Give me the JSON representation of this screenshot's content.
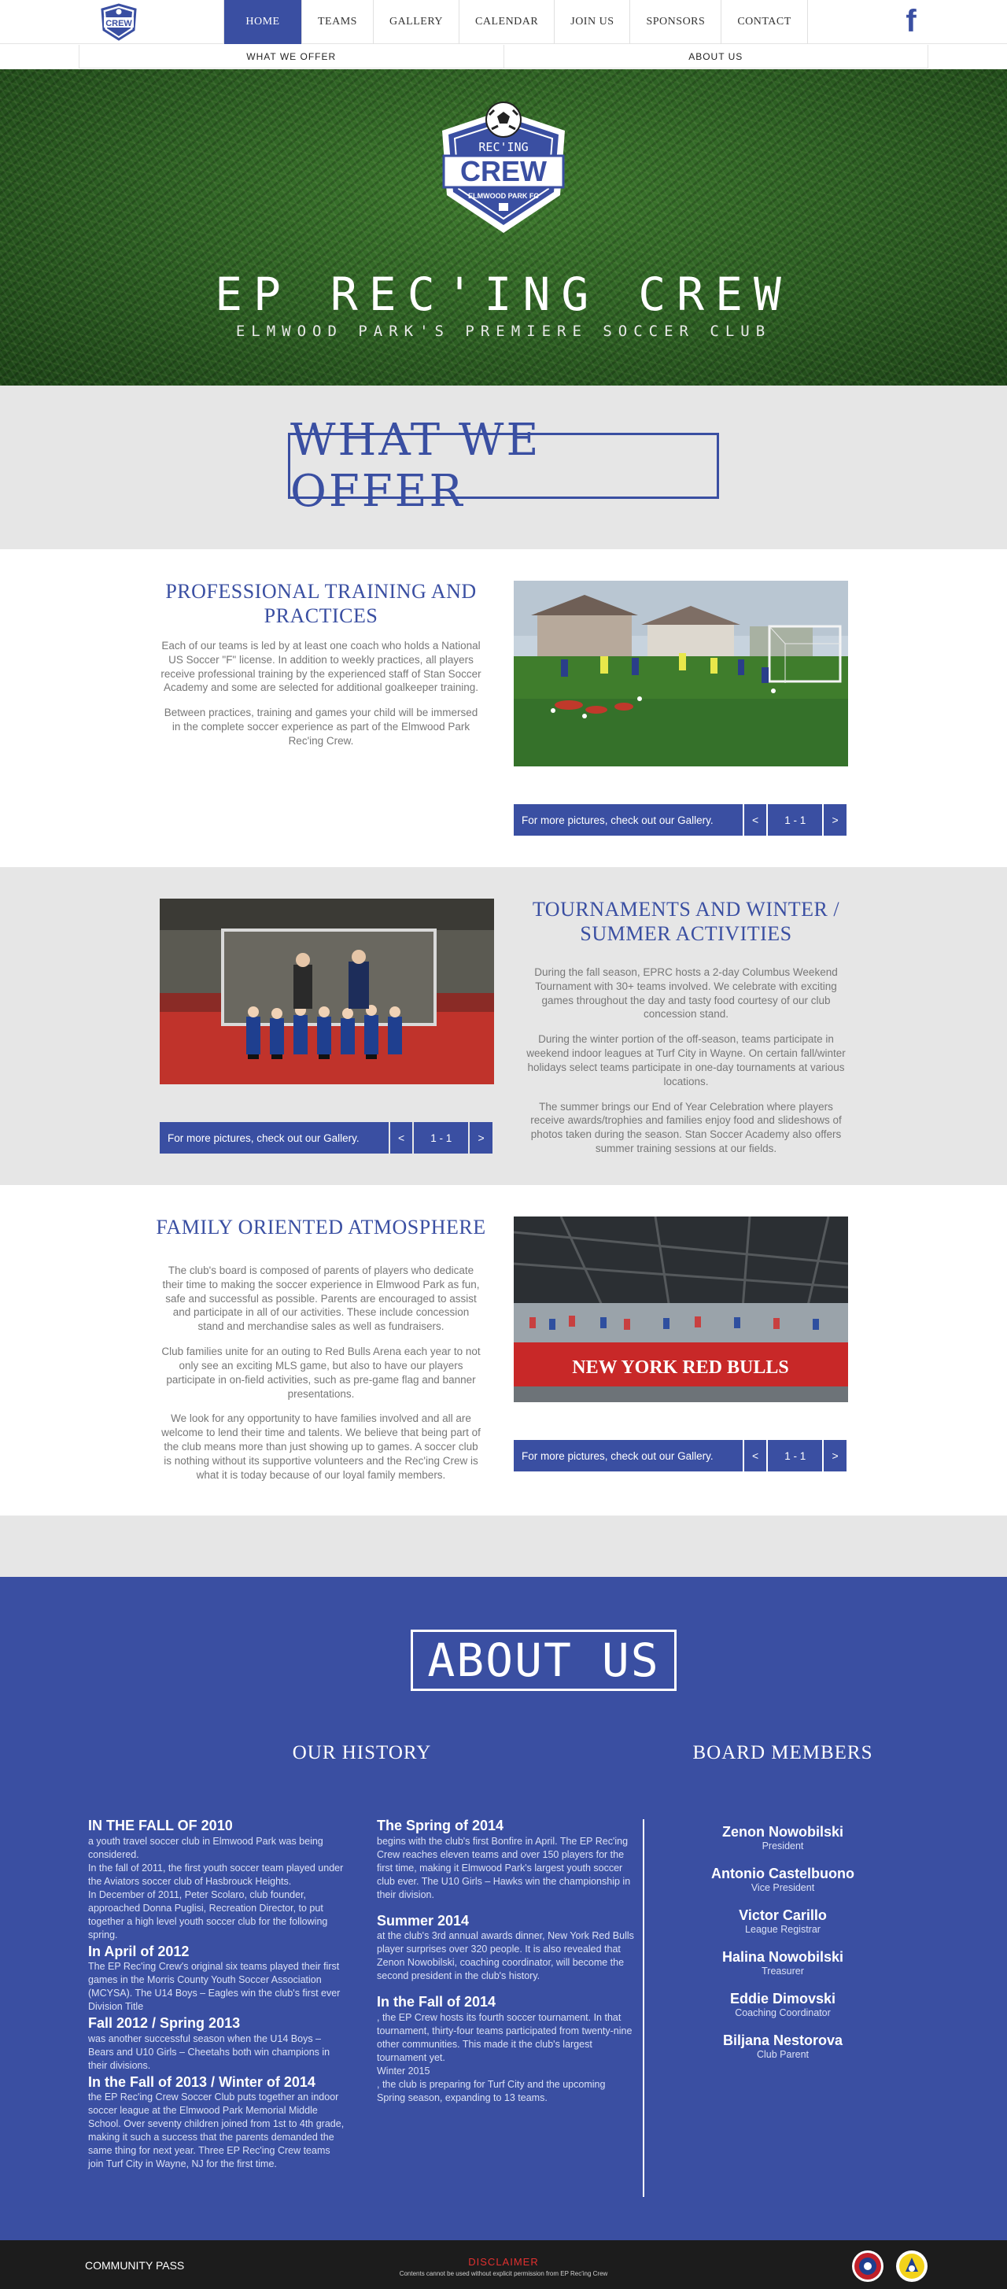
{
  "nav": {
    "items": [
      {
        "label": "HOME",
        "active": true
      },
      {
        "label": "TEAMS"
      },
      {
        "label": "GALLERY"
      },
      {
        "label": "CALENDAR"
      },
      {
        "label": "JOIN US"
      },
      {
        "label": "SPONSORS"
      },
      {
        "label": "CONTACT"
      }
    ],
    "social_icon": "facebook-icon"
  },
  "subnav": [
    "WHAT WE OFFER",
    "ABOUT US"
  ],
  "hero": {
    "title": "EP REC'ING CREW",
    "subtitle": "ELMWOOD PARK'S PREMIERE SOCCER CLUB",
    "crest": {
      "top": "REC'ING",
      "main": "CREW",
      "bottom": "ELMWOOD PARK FC"
    }
  },
  "offer": {
    "title": "WHAT WE OFFER",
    "blocks": [
      {
        "heading": "PROFESSIONAL TRAINING AND PRACTICES",
        "paragraphs": [
          "Each of our teams is led by at least one coach who holds a National US Soccer \"F\" license. In addition to weekly practices, all players receive professional training by the experienced staff of Stan Soccer Academy and some are selected for additional goalkeeper training.",
          "Between practices, training and games your child will be immersed in the complete soccer experience as part of the Elmwood Park Rec'ing Crew."
        ],
        "gallery": {
          "label": "For more pictures, check out our Gallery.",
          "prev": "<",
          "count": "1 - 1",
          "next": ">"
        }
      },
      {
        "heading": "TOURNAMENTS AND WINTER / SUMMER ACTIVITIES",
        "paragraphs": [
          "During the fall season, EPRC hosts a 2-day Columbus Weekend Tournament with 30+ teams involved. We celebrate with exciting games throughout the day and tasty food courtesy of our club concession stand.",
          "During the winter portion of the off-season, teams participate in weekend indoor leagues at Turf City in Wayne. On certain fall/winter holidays select teams participate in one-day tournaments at various locations.",
          "The summer brings our End of Year Celebration where players receive awards/trophies and families enjoy food and slideshows of photos taken during the season. Stan Soccer Academy also offers summer training sessions at our fields."
        ],
        "gallery": {
          "label": "For more pictures, check out our Gallery.",
          "prev": "<",
          "count": "1 - 1",
          "next": ">"
        }
      },
      {
        "heading": "FAMILY ORIENTED ATMOSPHERE",
        "paragraphs": [
          "The club's board is composed of parents of players who dedicate their time to making the soccer experience in Elmwood Park as fun, safe and successful as possible. Parents are encouraged to assist and participate in all of our activities. These include concession stand and merchandise sales as well as fundraisers.",
          "Club families unite for an outing to Red Bulls Arena each year to not only see an exciting MLS game, but also to have our players participate in on-field activities, such as pre-game flag and banner presentations.",
          "We look for any opportunity to have families involved and all are welcome to lend their time and talents. We believe that being part of the club means more than just showing up to games. A soccer club is nothing without its supportive volunteers and the Rec'ing Crew is what it is today because of our loyal family members."
        ],
        "gallery": {
          "label": "For more pictures, check out our Gallery.",
          "prev": "<",
          "count": "1 - 1",
          "next": ">"
        },
        "banner_text": "NEW YORK RED BULLS"
      }
    ]
  },
  "about": {
    "title": "ABOUT US",
    "history_heading": "OUR HISTORY",
    "board_heading": "BOARD MEMBERS",
    "history_left": [
      {
        "heading": "IN THE FALL OF 2010",
        "text": "a youth travel soccer club in Elmwood Park was being considered.\nIn the fall of 2011, the first youth soccer team played under the Aviators soccer club of Hasbrouck Heights.\nIn December of 2011, Peter Scolaro, club founder, approached Donna Puglisi, Recreation Director, to put together a high level youth soccer club for the following spring."
      },
      {
        "heading": "In April of 2012",
        "text": "The EP Rec'ing Crew's original six teams played their first games in the Morris County Youth Soccer Association (MCYSA). The U14 Boys – Eagles win the club's first ever Division Title"
      },
      {
        "heading": "Fall 2012 / Spring 2013",
        "text": "was another successful season when the U14 Boys – Bears and U10 Girls – Cheetahs both win champions in their divisions."
      },
      {
        "heading": "In the Fall of 2013 / Winter of 2014",
        "text": " the EP Rec'ing Crew Soccer Club puts together an indoor soccer league at the Elmwood Park Memorial Middle School. Over seventy children joined from 1st to 4th grade, making it such a success that the parents demanded the same thing for next year. Three EP Rec'ing Crew teams join Turf City in Wayne, NJ for the first time."
      }
    ],
    "history_right": [
      {
        "heading": "The Spring of 2014",
        "text": "begins with the club's first Bonfire in April. The EP Rec'ing Crew reaches eleven teams and over 150 players for the first time, making it Elmwood Park's largest youth soccer club ever. The U10 Girls – Hawks win the championship in their division."
      },
      {
        "heading": "Summer 2014",
        "text": "at the club's 3rd annual awards dinner, New York Red Bulls player surprises over 320 people. It is also revealed that Zenon Nowobilski, coaching coordinator, will become the second president in the club's history."
      },
      {
        "heading": "In the Fall of 2014",
        "text": ", the EP Crew hosts its fourth soccer tournament. In that tournament, thirty-four teams participated from twenty-nine other communities. This made it the club's largest tournament yet.\nWinter 2015\n, the club is preparing for Turf City and the upcoming Spring season, expanding to 13 teams."
      }
    ],
    "board": [
      {
        "name": "Zenon Nowobilski",
        "role": "President"
      },
      {
        "name": "Antonio Castelbuono",
        "role": "Vice President"
      },
      {
        "name": "Victor Carillo",
        "role": "League Registrar"
      },
      {
        "name": "Halina Nowobilski",
        "role": "Treasurer"
      },
      {
        "name": "Eddie Dimovski",
        "role": "Coaching Coordinator"
      },
      {
        "name": "Biljana Nestorova",
        "role": "Club Parent"
      }
    ]
  },
  "footer": {
    "left_link": "COMMUNITY PASS",
    "disclaimer": "DISCLAIMER",
    "disclaimer_sub": "Contents cannot be used without explicit permission from EP Rec'ing Crew"
  },
  "colors": {
    "brand_blue": "#3a4fa2",
    "grey_band": "#e6e6e6",
    "footer": "#1c1c1c",
    "disclaimer_red": "#e03030"
  }
}
